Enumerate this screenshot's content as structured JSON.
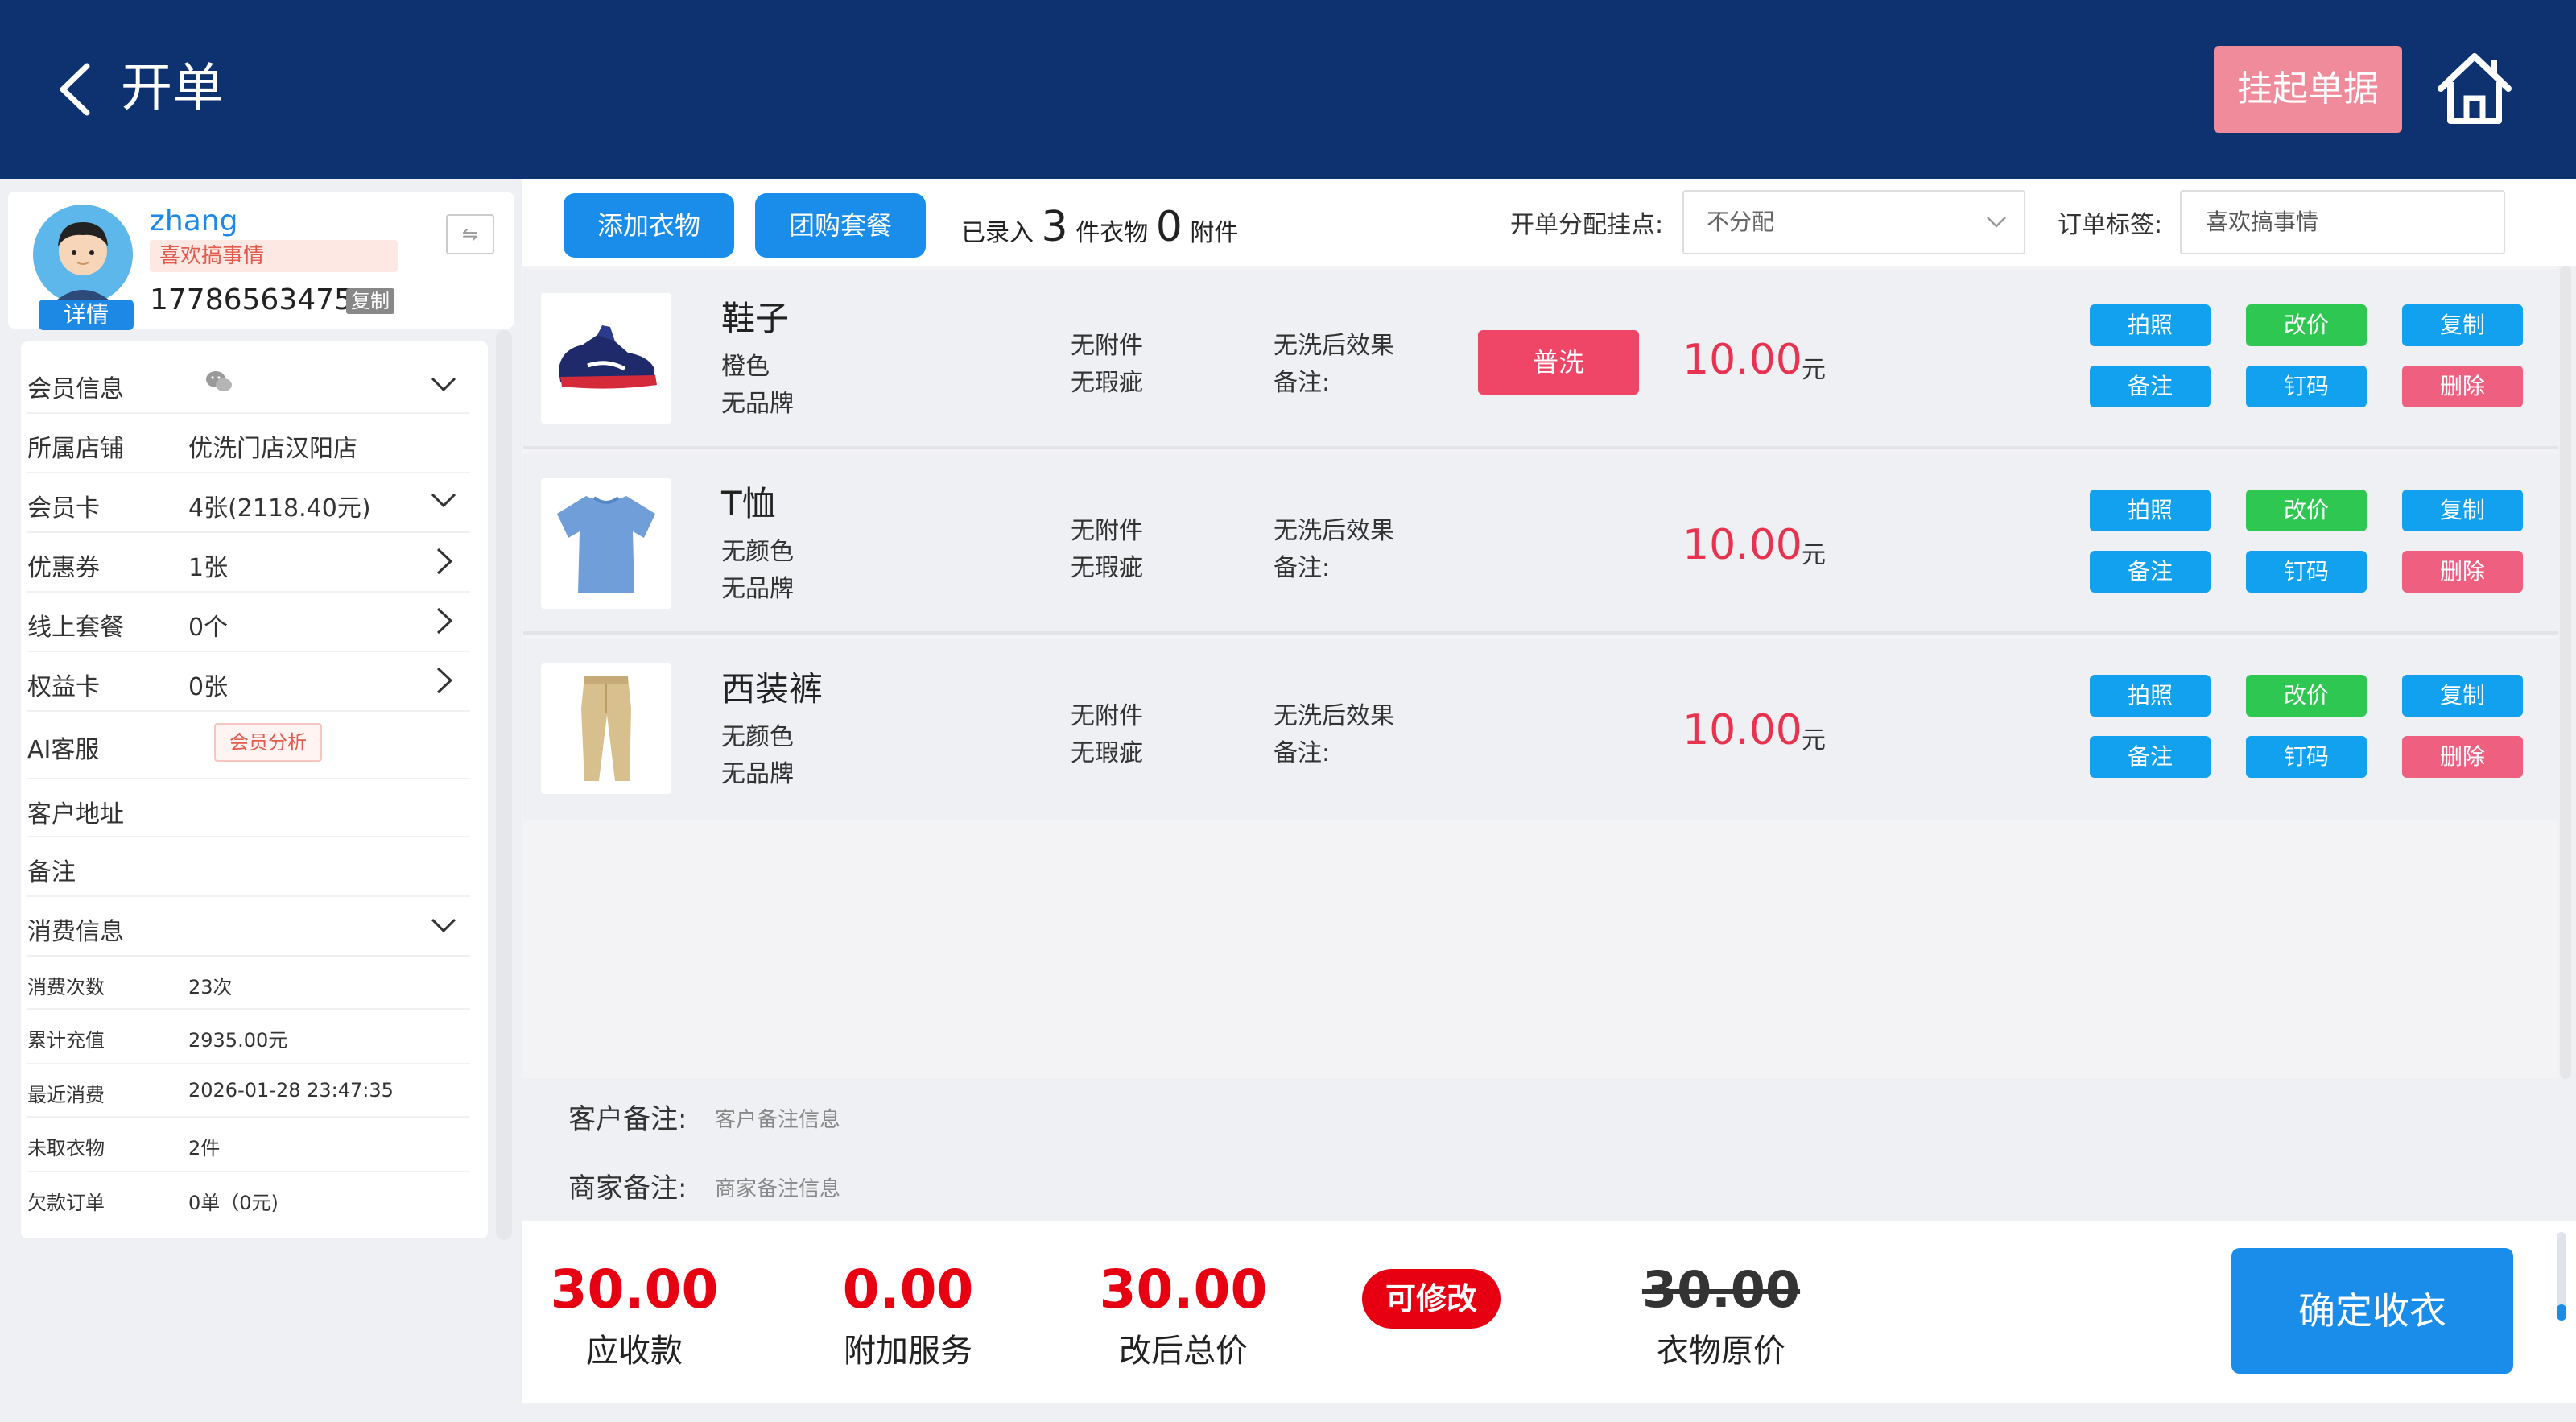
{
  "header": {
    "title": "开单",
    "suspend_label": "挂起单据"
  },
  "profile": {
    "username": "zhang",
    "tag": "喜欢搞事情",
    "phone": "17786563475",
    "copy_label": "复制",
    "detail_label": "详情",
    "switch_label": "⇋"
  },
  "member_info": {
    "rows": [
      {
        "label": "会员信息",
        "value": "",
        "arrow": "chevron-down"
      },
      {
        "label": "所属店铺",
        "value": "优洗门店汉阳店",
        "arrow": ""
      },
      {
        "label": "会员卡",
        "value": "4张(2118.40元)",
        "arrow": "chevron-down"
      },
      {
        "label": "优惠券",
        "value": "1张",
        "arrow": "chevron-right"
      },
      {
        "label": "线上套餐",
        "value": "0个",
        "arrow": "chevron-right"
      },
      {
        "label": "权益卡",
        "value": "0张",
        "arrow": "chevron-right"
      },
      {
        "label": "AI客服",
        "value": "",
        "arrow": ""
      },
      {
        "label": "客户地址",
        "value": "",
        "arrow": ""
      },
      {
        "label": "备注",
        "value": "",
        "arrow": ""
      },
      {
        "label": "消费信息",
        "value": "",
        "arrow": "chevron-down"
      }
    ],
    "analysis_tag": "会员分析",
    "consumption": [
      {
        "label": "消费次数",
        "value": "23次"
      },
      {
        "label": "累计充值",
        "value": "2935.00元"
      },
      {
        "label": "最近消费",
        "value": "2026-01-28 23:47:35"
      },
      {
        "label": "未取衣物",
        "value": "2件"
      },
      {
        "label": "欠款订单",
        "value": "0单（0元)"
      }
    ]
  },
  "toolbar": {
    "add_clothes": "添加衣物",
    "group_package": "团购套餐",
    "entered_prefix": "已录入",
    "clothes_count": "3",
    "clothes_suffix": "件衣物",
    "attach_count": "0",
    "attach_suffix": "附件",
    "assign_label": "开单分配挂点:",
    "assign_value": "不分配",
    "order_tag_label": "订单标签:",
    "order_tag_value": "喜欢搞事情"
  },
  "items": [
    {
      "name": "鞋子",
      "color": "橙色",
      "brand": "无品牌",
      "attachment": "无附件",
      "defect": "无瑕疵",
      "effect": "无洗后效果",
      "remark": "备注:",
      "wash": "普洗",
      "price": "10.00",
      "unit": "元",
      "thumb": "sneaker"
    },
    {
      "name": "T恤",
      "color": "无颜色",
      "brand": "无品牌",
      "attachment": "无附件",
      "defect": "无瑕疵",
      "effect": "无洗后效果",
      "remark": "备注:",
      "wash": "",
      "price": "10.00",
      "unit": "元",
      "thumb": "tshirt"
    },
    {
      "name": "西装裤",
      "color": "无颜色",
      "brand": "无品牌",
      "attachment": "无附件",
      "defect": "无瑕疵",
      "effect": "无洗后效果",
      "remark": "备注:",
      "wash": "",
      "price": "10.00",
      "unit": "元",
      "thumb": "trousers"
    }
  ],
  "item_actions": {
    "photo": "拍照",
    "change_price": "改价",
    "copy": "复制",
    "note": "备注",
    "tag_code": "钉码",
    "delete": "删除"
  },
  "remarks": {
    "customer_label": "客户备注:",
    "customer_value": "客户备注信息",
    "merchant_label": "商家备注:",
    "merchant_value": "商家备注信息"
  },
  "summary": {
    "receivable": "30.00",
    "receivable_label": "应收款",
    "extra": "0.00",
    "extra_label": "附加服务",
    "adjusted": "30.00",
    "adjusted_label": "改后总价",
    "editable": "可修改",
    "original": "30.00",
    "original_label": "衣物原价",
    "confirm": "确定收衣"
  },
  "colors": {
    "header": "#0e3270",
    "primary": "#1a8cea",
    "price": "#e8324f",
    "total": "#e60012",
    "green": "#2ec751",
    "pink": "#ef6080"
  }
}
